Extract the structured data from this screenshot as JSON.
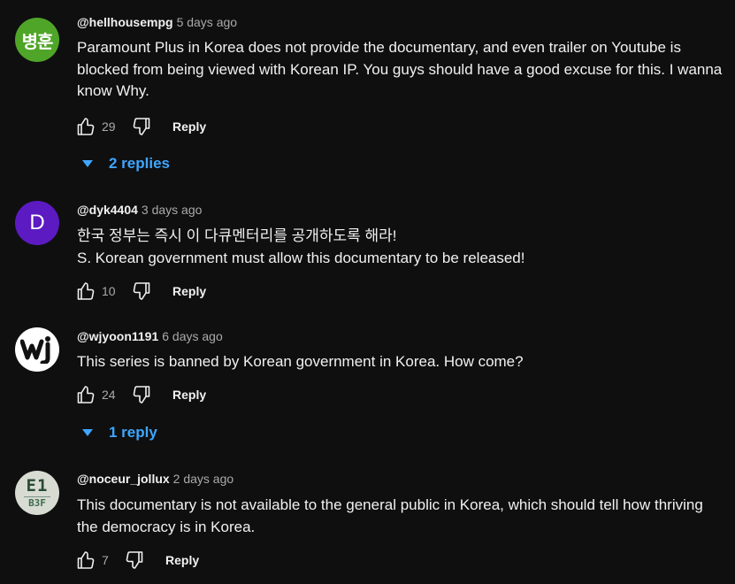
{
  "comments": [
    {
      "avatar_text": "병훈",
      "avatar_color": "#4fa528",
      "handle": "@hellhousempg",
      "time": "5 days ago",
      "lines": [
        "Paramount Plus in Korea does not provide the documentary, and even trailer on Youtube is blocked from being viewed with Korean IP. You guys should have a good excuse for this. I wanna know Why."
      ],
      "likes": "29",
      "reply_label": "Reply",
      "replies_label": "2 replies"
    },
    {
      "avatar_text": "D",
      "avatar_color": "#5c1ac2",
      "handle": "@dyk4404",
      "time": "3 days ago",
      "lines": [
        "한국 정부는 즉시 이 다큐멘터리를 공개하도록 해라!",
        "S. Korean government must allow this documentary to be released!"
      ],
      "likes": "10",
      "reply_label": "Reply"
    },
    {
      "avatar_logo": "wj-logo",
      "avatar_color": "#ffffff",
      "handle": "@wjyoon1191",
      "time": "6 days ago",
      "lines": [
        "This series is banned by Korean government in Korea. How come?"
      ],
      "likes": "24",
      "reply_label": "Reply",
      "replies_label": "1 reply"
    },
    {
      "avatar_text_top": "E1",
      "avatar_text_bottom": "B3F",
      "avatar_color": "#d7dbd2",
      "handle": "@noceur_jollux",
      "time": "2 days ago",
      "lines": [
        "This documentary is not available to the general public in Korea, which should tell how thriving the democracy is in Korea."
      ],
      "likes": "7",
      "reply_label": "Reply"
    }
  ],
  "icons": {
    "like": "thumbs-up-icon",
    "dislike": "thumbs-down-icon",
    "expand": "caret-down-icon"
  },
  "colors": {
    "background": "#0f0f0f",
    "link_blue": "#3ea6ff",
    "muted_text": "#aaaaaa"
  }
}
